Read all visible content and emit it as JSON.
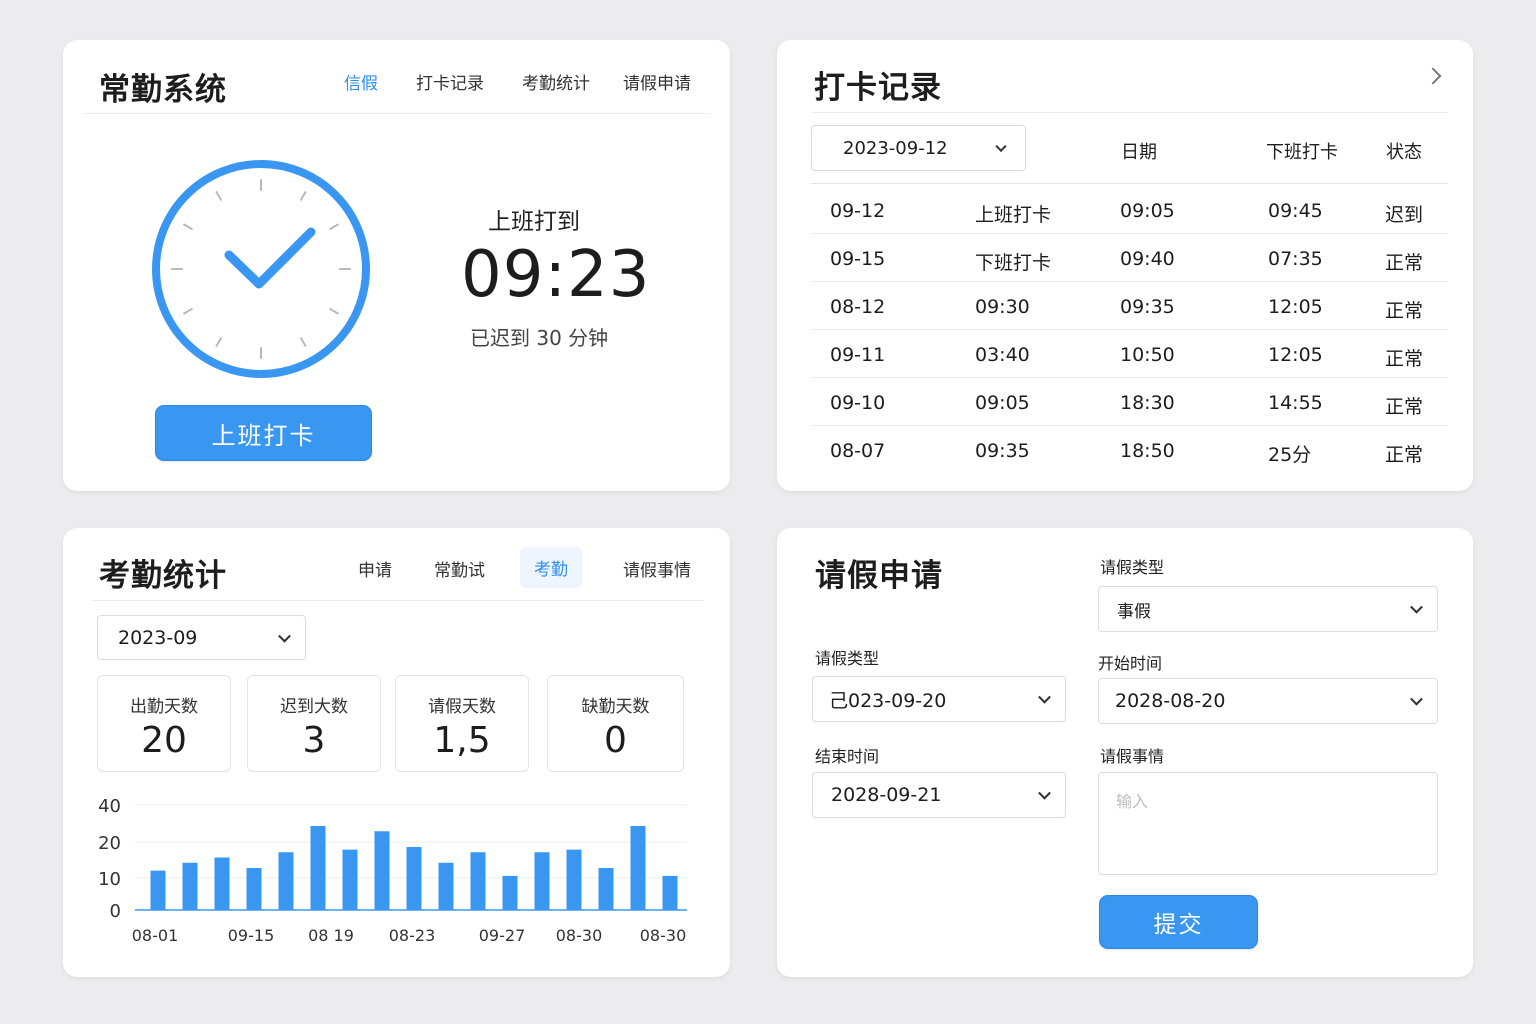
{
  "colors": {
    "accent": "#3a97f1",
    "nav_active": "#2f8ff0",
    "bar": "#3a97f1",
    "background": "#ececee"
  },
  "attendance": {
    "title": "常勤系统",
    "nav": [
      "信假",
      "打卡记录",
      "考勤统计",
      "请假申请"
    ],
    "nav_active": 0,
    "status_label": "上班打到",
    "time": "09:23",
    "late_text": "已迟到 30 分钟",
    "clock_in_button": "上班打卡",
    "clock_icon": "clock-check-icon"
  },
  "records": {
    "title": "打卡记录",
    "next_icon": "chevron-right-icon",
    "date_select": "2023-09-12",
    "columns": [
      "日期",
      "下班打卡",
      "状态"
    ],
    "rows": [
      [
        "09-12",
        "上班打卡",
        "09:05",
        "09:45",
        "迟到"
      ],
      [
        "09-15",
        "下班打卡",
        "09:40",
        "07:35",
        "正常"
      ],
      [
        "08-12",
        "09:30",
        "09:35",
        "12:05",
        "正常"
      ],
      [
        "09-11",
        "03:40",
        "10:50",
        "12:05",
        "正常"
      ],
      [
        "09-10",
        "09:05",
        "18:30",
        "14:55",
        "正常"
      ],
      [
        "08-07",
        "09:35",
        "18:50",
        "25分",
        "正常"
      ]
    ]
  },
  "stats": {
    "title": "考勤统计",
    "tabs": [
      "申请",
      "常勤试",
      "考勤",
      "请假事情"
    ],
    "tab_active": 2,
    "month_select": "2023-09",
    "cards": [
      {
        "label": "出勤天数",
        "value": "20"
      },
      {
        "label": "迟到大数",
        "value": "3"
      },
      {
        "label": "请假天数",
        "value": "1,5"
      },
      {
        "label": "缺勤天数",
        "value": "0"
      }
    ]
  },
  "chart_data": {
    "type": "bar",
    "y_ticks": [
      "40",
      "20",
      "10",
      "0"
    ],
    "x_labels": [
      "08-01",
      "09-15",
      "08 19",
      "08-23",
      "09-27",
      "08-30",
      "08-30"
    ],
    "values": [
      15,
      18,
      20,
      16,
      22,
      32,
      23,
      30,
      24,
      18,
      22,
      13,
      22,
      23,
      16,
      32,
      13
    ],
    "ylim": [
      0,
      40
    ],
    "grid": true
  },
  "leave": {
    "title": "请假申请",
    "type_label": "请假类型",
    "type_value": "事假",
    "left_type_label": "请假类型",
    "start_label": "开始时间",
    "start_left_value": "己023-09-20",
    "start_value": "2028-08-20",
    "end_label": "结束时间",
    "end_value": "2028-09-21",
    "reason_label": "请假事情",
    "reason_placeholder": "输入",
    "submit_button": "提交"
  }
}
